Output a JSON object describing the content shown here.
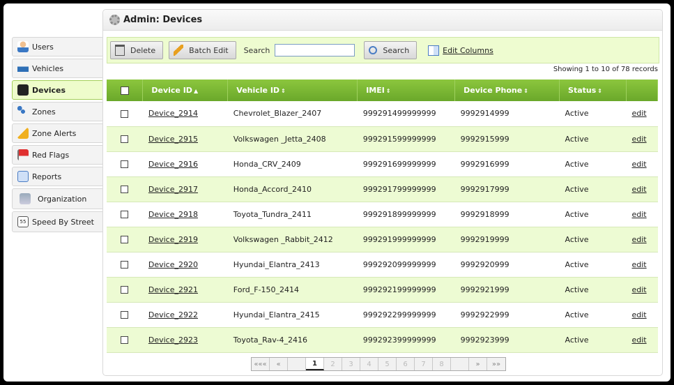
{
  "sidebar": {
    "items": [
      {
        "label": "Users",
        "icon": "users-icon"
      },
      {
        "label": "Vehicles",
        "icon": "vehicle-icon"
      },
      {
        "label": "Devices",
        "icon": "device-icon",
        "active": true
      },
      {
        "label": "Zones",
        "icon": "zones-icon"
      },
      {
        "label": "Zone Alerts",
        "icon": "zone-alert-icon"
      },
      {
        "label": "Red Flags",
        "icon": "red-flag-icon"
      },
      {
        "label": "Reports",
        "icon": "reports-icon"
      },
      {
        "label": "Organization",
        "icon": "organization-icon"
      },
      {
        "label": "Speed By Street",
        "icon": "speed-sign-icon"
      }
    ]
  },
  "header": {
    "title": "Admin: Devices"
  },
  "toolbar": {
    "delete_label": "Delete",
    "batch_edit_label": "Batch Edit",
    "search_label": "Search",
    "search_value": "",
    "search_button_label": "Search",
    "edit_columns_label": "Edit Columns"
  },
  "showing": "Showing 1 to 10 of 78 records",
  "table": {
    "columns": [
      "Device ID",
      "Vehicle ID",
      "IMEI",
      "Device Phone",
      "Status"
    ],
    "sort_icons": [
      "▲",
      "⇕",
      "⇕",
      "⇕",
      "⇕"
    ],
    "edit_label": "edit",
    "rows": [
      {
        "device_id": "Device_2914",
        "vehicle_id": "Chevrolet_Blazer_2407",
        "imei": "999291499999999",
        "phone": "9992914999",
        "status": "Active"
      },
      {
        "device_id": "Device_2915",
        "vehicle_id": "Volkswagen _Jetta_2408",
        "imei": "999291599999999",
        "phone": "9992915999",
        "status": "Active"
      },
      {
        "device_id": "Device_2916",
        "vehicle_id": "Honda_CRV_2409",
        "imei": "999291699999999",
        "phone": "9992916999",
        "status": "Active"
      },
      {
        "device_id": "Device_2917",
        "vehicle_id": "Honda_Accord_2410",
        "imei": "999291799999999",
        "phone": "9992917999",
        "status": "Active"
      },
      {
        "device_id": "Device_2918",
        "vehicle_id": "Toyota_Tundra_2411",
        "imei": "999291899999999",
        "phone": "9992918999",
        "status": "Active"
      },
      {
        "device_id": "Device_2919",
        "vehicle_id": "Volkswagen _Rabbit_2412",
        "imei": "999291999999999",
        "phone": "9992919999",
        "status": "Active"
      },
      {
        "device_id": "Device_2920",
        "vehicle_id": "Hyundai_Elantra_2413",
        "imei": "999292099999999",
        "phone": "9992920999",
        "status": "Active"
      },
      {
        "device_id": "Device_2921",
        "vehicle_id": "Ford_F-150_2414",
        "imei": "999292199999999",
        "phone": "9992921999",
        "status": "Active"
      },
      {
        "device_id": "Device_2922",
        "vehicle_id": "Hyundai_Elantra_2415",
        "imei": "999292299999999",
        "phone": "9992922999",
        "status": "Active"
      },
      {
        "device_id": "Device_2923",
        "vehicle_id": "Toyota_Rav-4_2416",
        "imei": "999292399999999",
        "phone": "9992923999",
        "status": "Active"
      }
    ]
  },
  "pagination": {
    "first": "«««",
    "prev": "«",
    "pages": [
      "1",
      "2",
      "3",
      "4",
      "5",
      "6",
      "7",
      "8"
    ],
    "current": "1",
    "next": "»",
    "last": "»»"
  },
  "colors": {
    "accent_green": "#7ab637",
    "row_alt": "#edfbd3",
    "toolbar_bg": "#eefcd0"
  }
}
